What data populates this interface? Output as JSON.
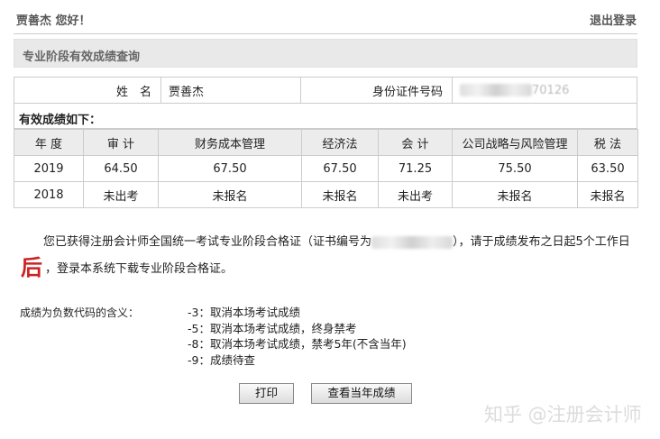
{
  "header": {
    "greeting": "贾善杰 您好！",
    "logout_label": "退出登录"
  },
  "section_title": "专业阶段有效成绩查询",
  "info": {
    "name_label": "姓　名",
    "name_value": "贾善杰",
    "id_label": "身份证件号码",
    "id_value_visible": "70126"
  },
  "scores_caption": "有效成绩如下：",
  "scores": {
    "headers": [
      "年 度",
      "审 计",
      "财务成本管理",
      "经济法",
      "会 计",
      "公司战略与风险管理",
      "税 法"
    ],
    "rows": [
      [
        "2019",
        "64.50",
        "67.50",
        "67.50",
        "71.25",
        "75.50",
        "63.50"
      ],
      [
        "2018",
        "未出考",
        "未报名",
        "未报名",
        "未出考",
        "未报名",
        "未报名"
      ]
    ]
  },
  "notice": {
    "part1": "您已获得注册会计师全国统一考试专业阶段合格证（证书编号为",
    "part2": "），请于成绩发布之日起5个工作日",
    "emphasis": "后",
    "part3": "，登录本系统下载专业阶段合格证。"
  },
  "codes": {
    "label": "成绩为负数代码的含义：",
    "items": [
      "-3：取消本场考试成绩",
      "-5：取消本场考试成绩，终身禁考",
      "-8：取消本场考试成绩，禁考5年(不含当年)",
      "-9：成绩待查"
    ]
  },
  "buttons": {
    "print": "打印",
    "view_current": "查看当年成绩"
  },
  "watermark": "知乎 @注册会计师"
}
